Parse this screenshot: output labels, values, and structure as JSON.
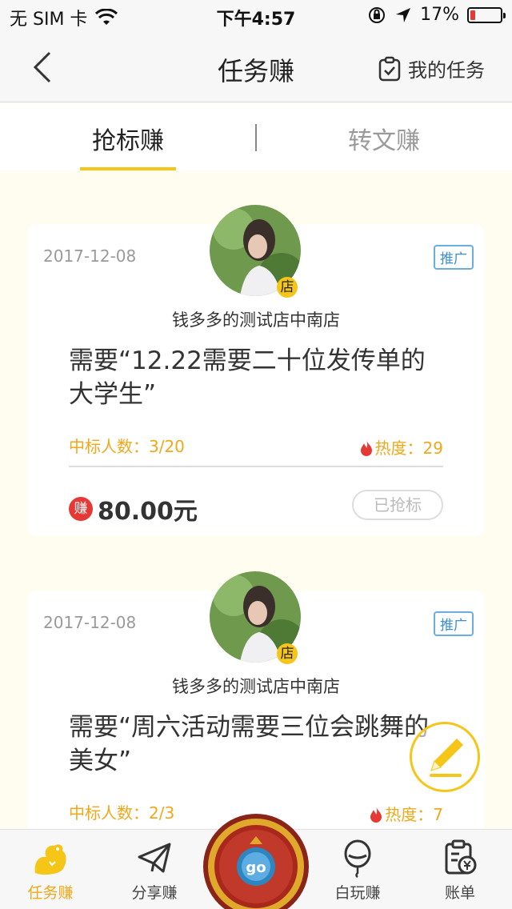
{
  "status_bar": {
    "carrier": "无 SIM 卡",
    "time": "下午4:57",
    "battery_percent": "17%",
    "battery_level": 0.17
  },
  "nav": {
    "title": "任务赚",
    "my_tasks_label": "我的任务"
  },
  "tabs": [
    {
      "label": "抢标赚",
      "active": true
    },
    {
      "label": "转文赚",
      "active": false
    }
  ],
  "cards": [
    {
      "date": "2017-12-08",
      "tag": "推广",
      "shop_badge": "店",
      "shop_name": "钱多多的测试店中南店",
      "title": "需要“12.22需要二十位发传单的大学生”",
      "bid_count": "中标人数：3/20",
      "heat": "热度：29",
      "earn_badge": "赚",
      "price": "80.00元",
      "button": "已抢标"
    },
    {
      "date": "2017-12-08",
      "tag": "推广",
      "shop_badge": "店",
      "shop_name": "钱多多的测试店中南店",
      "title": "需要“周六活动需要三位会跳舞的美女”",
      "bid_count": "中标人数：2/3",
      "heat": "热度：7"
    }
  ],
  "bottom_nav": [
    {
      "label": "任务赚",
      "icon": "squirrel-icon",
      "active": true
    },
    {
      "label": "分享赚",
      "icon": "paper-plane-icon",
      "active": false
    },
    {
      "label": "",
      "icon": "go-icon",
      "center_text": "go"
    },
    {
      "label": "白玩赚",
      "icon": "balloon-icon",
      "active": false
    },
    {
      "label": "账单",
      "icon": "bill-icon",
      "active": false
    }
  ],
  "colors": {
    "accent": "#f5c518",
    "orange_text": "#f0a81a",
    "promo_blue": "#3a8ed6",
    "earn_red": "#e53935"
  }
}
